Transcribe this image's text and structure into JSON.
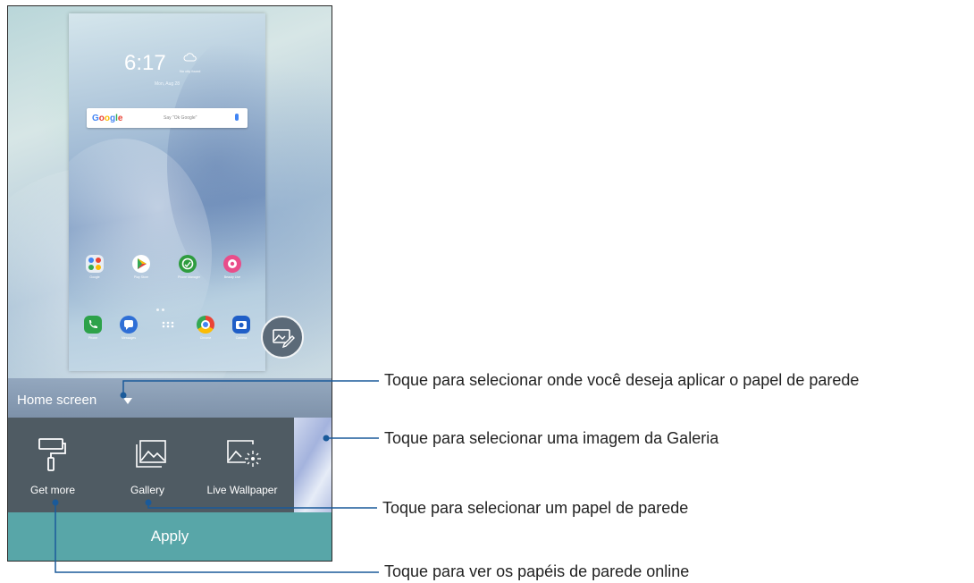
{
  "home_preview": {
    "time": "6:17",
    "weather": "No city found",
    "date": "Mon, Aug 28",
    "search": {
      "logo": [
        "G",
        "o",
        "o",
        "g",
        "l",
        "e"
      ],
      "placeholder": "Say \"Ok Google\""
    },
    "apps_row": [
      {
        "label": "Google",
        "icon": "folder-icon"
      },
      {
        "label": "Play Store",
        "icon": "play-store-icon"
      },
      {
        "label": "Phone Manager",
        "icon": "phone-manager-icon"
      },
      {
        "label": "Beauty Live",
        "icon": "beauty-live-icon"
      }
    ],
    "dock": [
      {
        "label": "Phone",
        "icon": "phone-icon"
      },
      {
        "label": "Messages",
        "icon": "messages-icon"
      },
      {
        "label": "",
        "icon": "app-drawer-icon"
      },
      {
        "label": "Chrome",
        "icon": "chrome-icon"
      },
      {
        "label": "Camera",
        "icon": "camera-icon"
      }
    ]
  },
  "target_selector": {
    "label": "Home screen",
    "icon": "caret-down-icon"
  },
  "picker": [
    {
      "label": "Get more",
      "icon": "paint-roller-icon"
    },
    {
      "label": "Gallery",
      "icon": "gallery-icon"
    },
    {
      "label": "Live Wallpaper",
      "icon": "live-wallpaper-icon"
    }
  ],
  "apply_label": "Apply",
  "callouts": [
    "Toque para selecionar onde você deseja aplicar o papel de parede",
    "Toque para selecionar uma imagem da Galeria",
    "Toque para selecionar um papel de parede",
    "Toque para ver os papéis de parede online"
  ],
  "colors": {
    "apply": "#58a6a8",
    "picker_bg": "#4f5b63",
    "callout_line": "#1a5a9a"
  }
}
